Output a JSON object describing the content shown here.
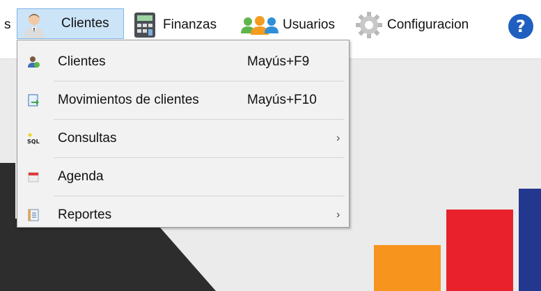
{
  "menubar": {
    "partial_label": "s",
    "clientes_label": "Clientes",
    "finanzas_label": "Finanzas",
    "usuarios_label": "Usuarios",
    "configuracion_label": "Configuracion"
  },
  "dropdown": {
    "items": [
      {
        "label": "Clientes",
        "shortcut": "Mayús+F9",
        "submenu": false,
        "icon": "client-icon"
      },
      {
        "label": "Movimientos de clientes",
        "shortcut": "Mayús+F10",
        "submenu": false,
        "icon": "document-arrow-icon"
      },
      {
        "label": "Consultas",
        "shortcut": "",
        "submenu": true,
        "icon": "sql-icon"
      },
      {
        "label": "Agenda",
        "shortcut": "",
        "submenu": false,
        "icon": "calendar-icon"
      },
      {
        "label": "Reportes",
        "shortcut": "",
        "submenu": true,
        "icon": "report-icon"
      }
    ],
    "sql_icon_text": "SQL",
    "submenu_arrow": "›"
  },
  "colors": {
    "highlight": "#cce4f7",
    "highlight_border": "#7eb4ea",
    "bar_orange": "#f7941d",
    "bar_red": "#e8212c",
    "bar_blue": "#24378f",
    "help_blue": "#1f5fbf"
  }
}
